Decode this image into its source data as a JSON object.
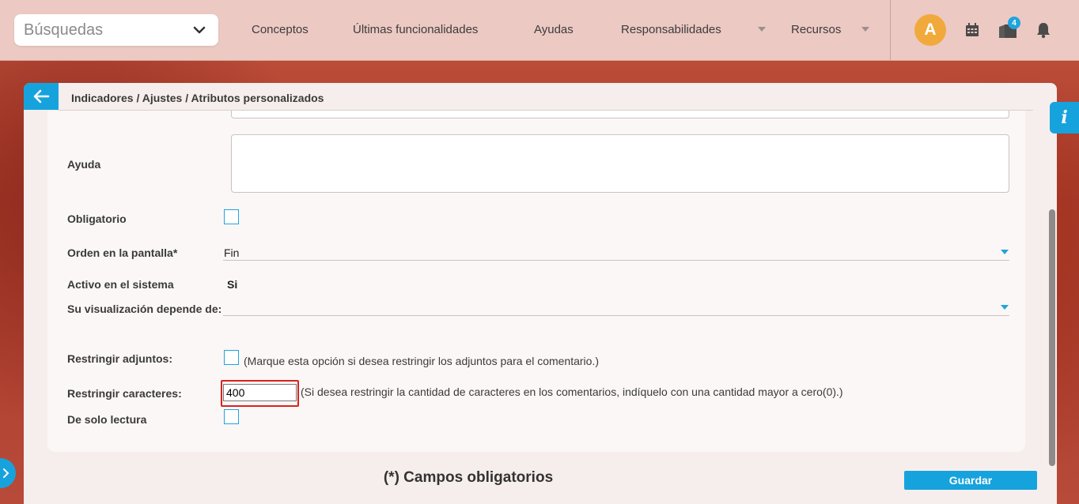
{
  "topbar": {
    "search_select": {
      "value": "Búsquedas",
      "icon": "chevron-down-icon"
    },
    "nav": [
      {
        "label": "Conceptos"
      },
      {
        "label": "Últimas funcionalidades"
      },
      {
        "label": "Ayudas"
      },
      {
        "label": "Responsabilidades"
      },
      {
        "label": "Recursos"
      }
    ],
    "avatar_initial": "A",
    "notifications_badge": "4"
  },
  "breadcrumb": "Indicadores / Ajustes / Atributos personalizados",
  "info_tab_label": "i",
  "form": {
    "help_label": "Ayuda",
    "required_label": "Obligatorio",
    "order_label": "Orden en la pantalla*",
    "order_value": "Fin",
    "active_label": "Activo en el sistema",
    "active_value": "Si",
    "depends_label": "Su visualización depende de:",
    "restrict_attachments_label": "Restringir adjuntos:",
    "restrict_attachments_hint": "(Marque esta opción si desea restringir los adjuntos para el comentario.)",
    "restrict_chars_label": "Restringir caracteres:",
    "restrict_chars_value": "400",
    "restrict_chars_hint": "(Si desea restringir la cantidad de caracteres en los comentarios, indíquelo con una cantidad mayor a cero(0).)",
    "readonly_label": "De solo lectura"
  },
  "footer": {
    "required_note": "(*) Campos obligatorios",
    "save_label": "Guardar"
  },
  "colors": {
    "accent": "#16a3dd",
    "highlight": "#d9221f",
    "avatar": "#f2a93b"
  }
}
